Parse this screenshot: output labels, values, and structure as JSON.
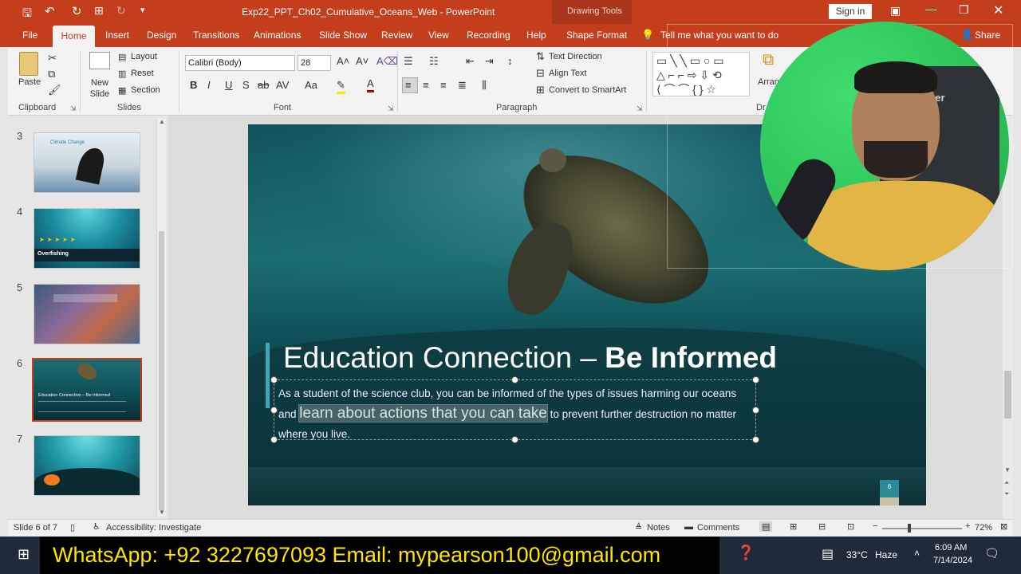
{
  "window": {
    "title": "Exp22_PPT_Ch02_Cumulative_Oceans_Web  -  PowerPoint",
    "context_tab_group": "Drawing Tools",
    "sign_in": "Sign in"
  },
  "ribbon_tabs": [
    "File",
    "Home",
    "Insert",
    "Design",
    "Transitions",
    "Animations",
    "Slide Show",
    "Review",
    "View",
    "Recording",
    "Help",
    "Shape Format"
  ],
  "tell_me": "Tell me what you want to do",
  "share": "Share",
  "clipboard": {
    "paste": "Paste",
    "label": "Clipboard"
  },
  "slides_group": {
    "new_slide": "New Slide",
    "layout": "Layout",
    "reset": "Reset",
    "section": "Section",
    "label": "Slides"
  },
  "font_group": {
    "font_name": "Calibri (Body)",
    "font_size": "28",
    "label": "Font",
    "bold": "B",
    "italic": "I",
    "underline": "U",
    "shadow": "S",
    "strike": "ab",
    "spacing": "AV",
    "case": "Aa"
  },
  "paragraph_group": {
    "text_direction": "Text Direction",
    "align_text": "Align Text",
    "convert_smartart": "Convert to SmartArt",
    "label": "Paragraph"
  },
  "drawing_group": {
    "arrange": "Arran",
    "label": "Dr"
  },
  "thumbnails": [
    {
      "num": "3",
      "title": "Climate Change"
    },
    {
      "num": "4",
      "title": "Overfishing"
    },
    {
      "num": "5",
      "title": ""
    },
    {
      "num": "6",
      "title": "Education Connection – Be Informed"
    },
    {
      "num": "7",
      "title": ""
    }
  ],
  "slide": {
    "title_regular": "Education Connection – ",
    "title_bold": "Be Informed",
    "body_before": "As a student of the science club, you can be informed of the types of issues harming our oceans and ",
    "body_highlight": "learn about actions that you can take",
    "body_after": " to prevent further destruction no matter where you live.",
    "page_number": "6"
  },
  "status": {
    "slide_info": "Slide 6 of 7",
    "accessibility": "Accessibility: Investigate",
    "notes": "Notes",
    "comments": "Comments",
    "zoom": "72%",
    "zoom_level": 0.72
  },
  "banner": {
    "text": "WhatsApp: +92 3227697093  Email: mypearson100@gmail.com"
  },
  "taskbar": {
    "temperature": "33°C",
    "weather": "Haze",
    "time": "6:09 AM",
    "date": "7/14/2024"
  },
  "webcam": {
    "chair_text": "ker"
  },
  "colors": {
    "accent": "#c43e1c",
    "slide_bg": "#0f4f57"
  }
}
